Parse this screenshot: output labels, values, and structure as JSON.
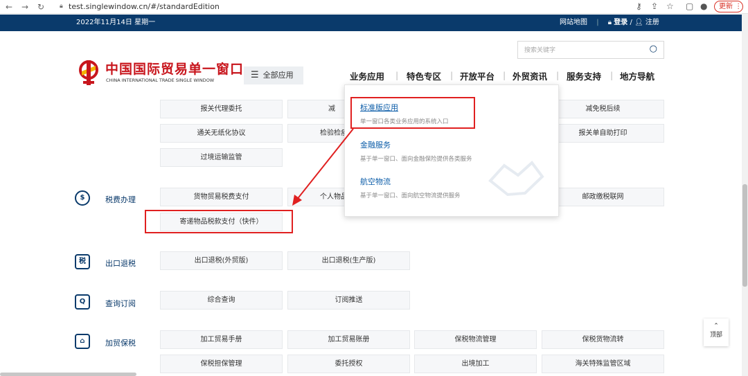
{
  "browser": {
    "url": "test.singlewindow.cn/#/standardEdition",
    "update_label": "更新 ⋮"
  },
  "topbar": {
    "date": "2022年11月14日 星期一",
    "sitemap": "网站地图",
    "login": "登录",
    "register": "注册"
  },
  "header": {
    "logo_cn": "中国国际贸易单一窗口",
    "logo_en": "CHINA INTERNATIONAL TRADE SINGLE WINDOW",
    "all_apps": "全部应用",
    "search_placeholder": "搜索关键字",
    "nav": [
      "业务应用",
      "特色专区",
      "开放平台",
      "外贸资讯",
      "服务支持",
      "地方导航"
    ]
  },
  "dropdown": {
    "items": [
      {
        "title": "标准版应用",
        "desc": "单一窗口各类业务应用的系统入口"
      },
      {
        "title": "金融服务",
        "desc": "基于单一窗口、面向金融保险提供各类服务"
      },
      {
        "title": "航空物流",
        "desc": "基于单一窗口、面向航空物流提供服务"
      }
    ]
  },
  "grid": {
    "row0": [
      "报关代理委托",
      "减",
      "减免税后续"
    ],
    "row1": [
      "通关无纸化协议",
      "检验检疫",
      "报关单自助打印"
    ],
    "row2": [
      "过境运输监管"
    ],
    "tax": {
      "label": "税费办理",
      "items": [
        "货物贸易税费支付",
        "个人物品",
        "邮政缴税联网",
        "寄递物品税款支付（快件）"
      ]
    },
    "export": {
      "label": "出口退税",
      "icon": "税",
      "items": [
        "出口退税(外贸版)",
        "出口退税(生产版)"
      ]
    },
    "query": {
      "label": "查询订阅",
      "items": [
        "综合查询",
        "订阅推送"
      ]
    },
    "bonded": {
      "label": "加贸保税",
      "items": [
        "加工贸易手册",
        "加工贸易账册",
        "保税物流管理",
        "保税货物流转",
        "保税担保管理",
        "委托授权",
        "出境加工",
        "海关特殊监管区域"
      ]
    }
  },
  "totop_label": "顶部",
  "colors": {
    "brand": "#0a3a6b",
    "highlight": "#e02020",
    "logo_red": "#c8161d"
  }
}
